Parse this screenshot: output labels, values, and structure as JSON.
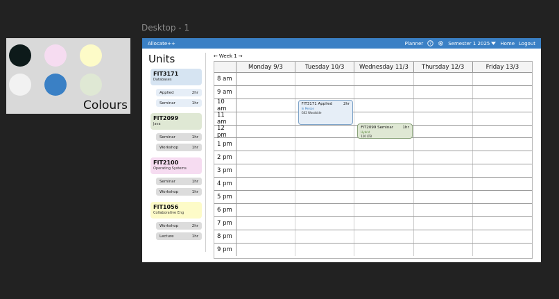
{
  "canvas": {
    "frame_label": "Desktop - 1"
  },
  "colours": {
    "label": "Colours",
    "swatches": [
      {
        "name": "black",
        "color": "#0d1a1a"
      },
      {
        "name": "pink",
        "color": "#f6dcf1"
      },
      {
        "name": "yellow",
        "color": "#fdfbc8"
      },
      {
        "name": "white",
        "color": "#f2f2f2"
      },
      {
        "name": "blue",
        "color": "#3a80c5"
      },
      {
        "name": "green",
        "color": "#dfe8d4"
      }
    ]
  },
  "navbar": {
    "brand": "Allocate++",
    "planner": "Planner",
    "help_icon": "help-circle-icon",
    "settings_icon": "gear-icon",
    "semester": "Semester 1 2025",
    "home": "Home",
    "logout": "Logout",
    "color": "#3a80c5"
  },
  "units": {
    "title": "Units",
    "list": [
      {
        "code": "FIT3171",
        "name": "Databases",
        "color": "#d6e4f2",
        "classes": [
          {
            "label": "Applied",
            "duration": "2hr"
          },
          {
            "label": "Seminar",
            "duration": "1hr"
          }
        ]
      },
      {
        "code": "FIT2099",
        "name": "Java",
        "color": "#dfe8d4",
        "classes": [
          {
            "label": "Seminar",
            "duration": "1hr"
          },
          {
            "label": "Workshop",
            "duration": "1hr"
          }
        ]
      },
      {
        "code": "FIT2100",
        "name": "Operating Systems",
        "color": "#f6dcf1",
        "classes": [
          {
            "label": "Seminar",
            "duration": "1hr"
          },
          {
            "label": "Workshop",
            "duration": "1hr"
          }
        ]
      },
      {
        "code": "FIT1056",
        "name": "Collaborative Eng",
        "color": "#fdfbc8",
        "classes": [
          {
            "label": "Workshop",
            "duration": "2hr"
          },
          {
            "label": "Lecture",
            "duration": "1hr"
          }
        ]
      }
    ]
  },
  "timetable": {
    "week_prev": "←",
    "week_label": "Week 1",
    "week_next": "→",
    "days": [
      "Monday 9/3",
      "Tuesday 10/3",
      "Wednesday 11/3",
      "Thursday 12/3",
      "Friday 13/3"
    ],
    "times": [
      "8 am",
      "9 am",
      "10 am",
      "11 am",
      "12 pm",
      "1 pm",
      "2 pm",
      "3 pm",
      "4 pm",
      "5 pm",
      "6 pm",
      "7 pm",
      "8 pm",
      "9 pm"
    ],
    "events": [
      {
        "title": "FIT3171 Applied",
        "duration": "2hr",
        "mode": "In Person",
        "room": "G02 Woodside",
        "day": 1,
        "start": 2,
        "length": 2,
        "color": "#e6eef7",
        "border": "#7ea3c8",
        "mode_color": "#3a80c5"
      },
      {
        "title": "FIT2099 Seminar",
        "duration": "1hr",
        "mode": "Hybrid",
        "room": "120 LTB",
        "day": 2,
        "start": 3.8,
        "length": 1.3,
        "color": "#dfe8d4",
        "border": "#8aa37a",
        "mode_color": "#5c8a3c"
      }
    ]
  }
}
